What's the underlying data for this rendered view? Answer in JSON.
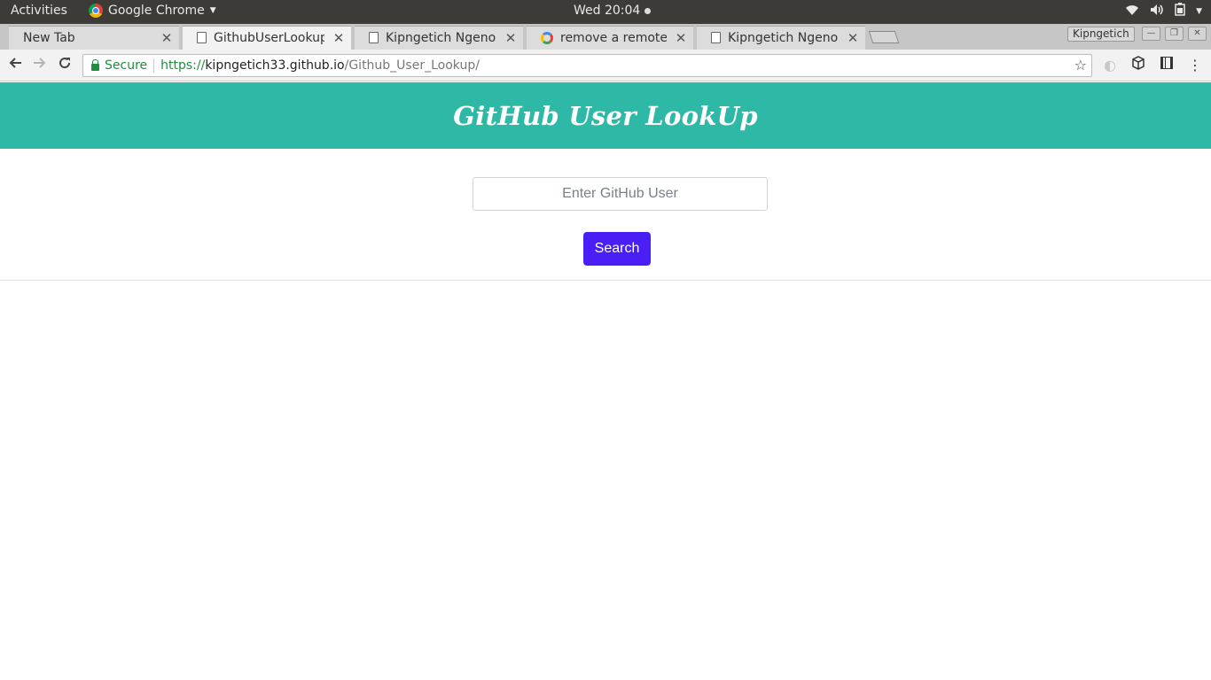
{
  "system_bar": {
    "activities": "Activities",
    "app_name": "Google Chrome",
    "clock": "Wed 20:04"
  },
  "browser": {
    "tabs": [
      {
        "title": "New Tab",
        "active": false,
        "favicon": "none"
      },
      {
        "title": "GithubUserLookup",
        "active": true,
        "favicon": "page-icon"
      },
      {
        "title": "Kipngetich Ngeno",
        "active": false,
        "favicon": "page-icon"
      },
      {
        "title": "remove a remote fr",
        "active": false,
        "favicon": "google-icon"
      },
      {
        "title": "Kipngetich Ngeno",
        "active": false,
        "favicon": "page-icon"
      }
    ],
    "profile_name": "Kipngetich",
    "address": {
      "secure_label": "Secure",
      "scheme": "https://",
      "host": "kipngetich33.github.io",
      "path": "/Github_User_Lookup/"
    }
  },
  "page": {
    "header_title": "GitHub User LookUp",
    "search": {
      "placeholder": "Enter GitHub User",
      "value": ""
    },
    "search_button_label": "Search"
  },
  "colors": {
    "header_bg": "#2eb8a6",
    "button_bg": "#4a1ff5",
    "secure_green": "#1e8e3e"
  }
}
